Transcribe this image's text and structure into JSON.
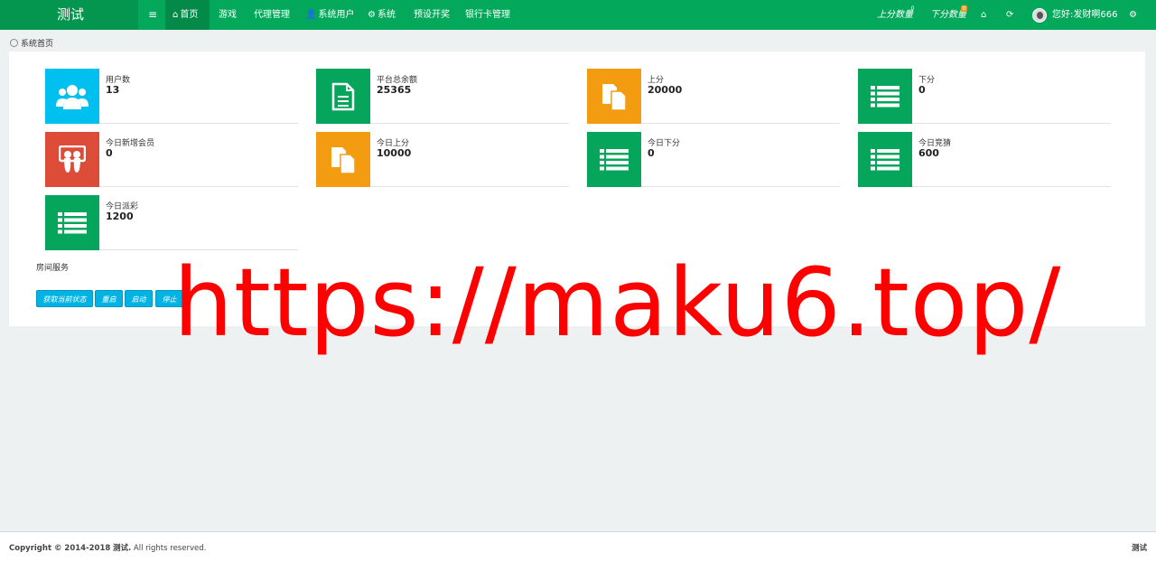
{
  "navbar": {
    "brand": "测试",
    "menu_toggle_icon": "≡",
    "items": [
      {
        "label": "首页",
        "icon": "home-icon",
        "active": true
      },
      {
        "label": "游戏",
        "icon": "",
        "active": false
      },
      {
        "label": "代理管理",
        "icon": "",
        "active": false
      },
      {
        "label": "系统用户",
        "icon": "user-icon",
        "active": false
      },
      {
        "label": "系统",
        "icon": "gear-icon",
        "active": false
      },
      {
        "label": "预设开奖",
        "icon": "",
        "active": false
      },
      {
        "label": "银行卡管理",
        "icon": "",
        "active": false
      }
    ],
    "right": {
      "up_count_label": "上分数量",
      "up_count_badge": "0",
      "down_count_label": "下分数量",
      "down_count_badge": "0",
      "user_greeting": "您好:发财啊666"
    },
    "bg_color": "#04a85a"
  },
  "breadcrumb": {
    "label": "系统首页"
  },
  "tiles": [
    {
      "label": "用户数",
      "value": "13",
      "icon": "users-icon",
      "color": "#00c0ef"
    },
    {
      "label": "平台总余额",
      "value": "25365",
      "icon": "document-icon",
      "color": "#05a65b"
    },
    {
      "label": "上分",
      "value": "20000",
      "icon": "copy-icon",
      "color": "#f39c12"
    },
    {
      "label": "下分",
      "value": "0",
      "icon": "list-icon",
      "color": "#05a65b"
    },
    {
      "label": "今日新增会员",
      "value": "0",
      "icon": "slideshare-icon",
      "color": "#dd4b39"
    },
    {
      "label": "今日上分",
      "value": "10000",
      "icon": "copy-icon",
      "color": "#f39c12"
    },
    {
      "label": "今日下分",
      "value": "0",
      "icon": "list-icon",
      "color": "#05a65b"
    },
    {
      "label": "今日竞猜",
      "value": "600",
      "icon": "list-icon",
      "color": "#05a65b"
    },
    {
      "label": "今日派彩",
      "value": "1200",
      "icon": "list-icon",
      "color": "#05a65b"
    }
  ],
  "room_service": {
    "title": "房间服务",
    "buttons": [
      "获取当前状态",
      "重启",
      "启动",
      "停止"
    ]
  },
  "watermark": "https://maku6.top/",
  "footer": {
    "copyright_prefix": "Copyright © 2014-2018",
    "copyright_name": "测试.",
    "copyright_suffix": "All rights reserved.",
    "right_text": "测试"
  }
}
